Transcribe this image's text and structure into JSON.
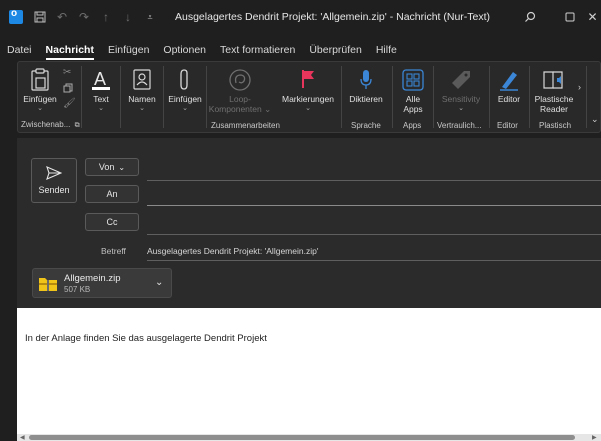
{
  "window": {
    "title": "Ausgelagertes Dendrit Projekt: 'Allgemein.zip'  -  Nachricht (Nur-Text)"
  },
  "tabs": [
    "Datei",
    "Nachricht",
    "Einfügen",
    "Optionen",
    "Text formatieren",
    "Überprüfen",
    "Hilfe"
  ],
  "active_tab": "Nachricht",
  "ribbon": {
    "einfuegen": "Einfügen",
    "text": "Text",
    "namen": "Namen",
    "einfuegen2": "Einfügen",
    "loop1": "Loop-",
    "loop2": "Komponenten",
    "markierungen": "Markierungen",
    "diktieren": "Diktieren",
    "alle1": "Alle",
    "alle2": "Apps",
    "sensitivity": "Sensitivity",
    "editor": "Editor",
    "plastische1": "Plastische",
    "plastische2": "Reader",
    "groups": {
      "zwischenablage": "Zwischenab...",
      "zusammenarbeiten": "Zusammenarbeiten",
      "sprache": "Sprache",
      "apps": "Apps",
      "vertraulich": "Vertraulich...",
      "editor": "Editor",
      "plastisch": "Plastisch"
    }
  },
  "compose": {
    "send": "Senden",
    "from": "Von",
    "to": "An",
    "cc": "Cc",
    "subject_label": "Betreff",
    "subject": "Ausgelagertes Dendrit Projekt: 'Allgemein.zip'"
  },
  "attachment": {
    "name": "Allgemein.zip",
    "size": "507 KB"
  },
  "body": {
    "text": "In der Anlage finden Sie das ausgelagerte Dendrit Projekt"
  },
  "colors": {
    "accent": "#1e88e5",
    "markierungen_flag": "#e8355c",
    "zip_icon": "#f0c419"
  }
}
